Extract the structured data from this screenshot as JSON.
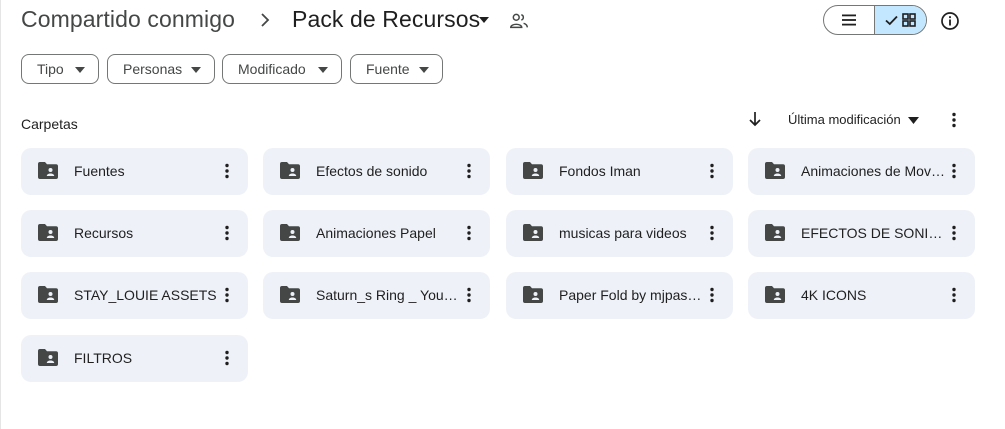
{
  "breadcrumb": {
    "parent": "Compartido conmigo",
    "current": "Pack de Recursos"
  },
  "icons": {
    "separator": "chevron-right-icon",
    "current_menu": "caret-down-icon",
    "shared": "people-icon",
    "list_view": "list-view-icon",
    "grid_view": "grid-view-icon",
    "info": "info-icon",
    "folder": "shared-folder-icon",
    "more": "more-vertical-icon",
    "sort_direction": "arrow-down-icon"
  },
  "view_toggle": {
    "selected": "grid"
  },
  "filters": [
    {
      "label": "Tipo"
    },
    {
      "label": "Personas"
    },
    {
      "label": "Modificado"
    },
    {
      "label": "Fuente"
    }
  ],
  "section": {
    "title": "Carpetas",
    "sort_label": "Última modificación"
  },
  "folders": [
    {
      "name": "Fuentes"
    },
    {
      "name": "Efectos de sonido"
    },
    {
      "name": "Fondos Iman"
    },
    {
      "name": "Animaciones de Movimiento"
    },
    {
      "name": "Recursos"
    },
    {
      "name": "Animaciones Papel"
    },
    {
      "name": "musicas para videos"
    },
    {
      "name": "EFECTOS DE SONIDO"
    },
    {
      "name": "STAY_LOUIE ASSETS"
    },
    {
      "name": "Saturn_s Ring _ YouTube"
    },
    {
      "name": "Paper Fold by mjpastor"
    },
    {
      "name": "4K ICONS"
    },
    {
      "name": "FILTROS"
    }
  ],
  "colors": {
    "card_background": "#eef2f8",
    "selected_toggle": "#c2e7ff",
    "text_primary": "#1f1f1f",
    "text_secondary": "#444746",
    "icon": "#444746"
  }
}
